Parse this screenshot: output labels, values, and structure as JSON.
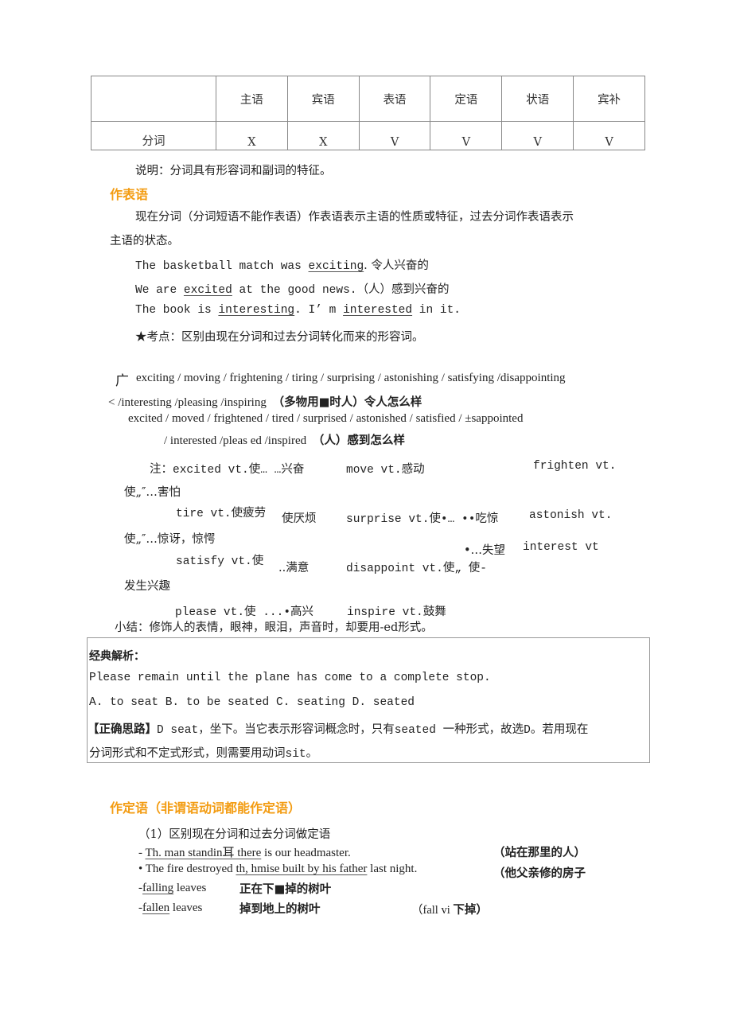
{
  "table": {
    "headers": [
      "",
      "主语",
      "宾语",
      "表语",
      "定语",
      "状语",
      "宾补"
    ],
    "rows": [
      [
        "分词",
        "X",
        "X",
        "V",
        "V",
        "V",
        "V"
      ]
    ]
  },
  "note": "说明：分词具有形容词和副词的特征。",
  "section1": {
    "heading": "作表语",
    "intro_line1": "现在分词（分词短语不能作表语）作表语表示主语的性质或特征，过去分词作表语表示",
    "intro_line2": "主语的状态。",
    "examples": [
      {
        "pre": "The basketball match was ",
        "u": "exciting",
        "post": ". 令人兴奋的"
      },
      {
        "pre": "We are ",
        "u": "excited",
        "post": " at the good news.（人）感到兴奋的"
      },
      {
        "pre": "The book is ",
        "u": "interesting",
        "mid": ". I’  m ",
        "u2": "interested",
        "post": " in it."
      }
    ],
    "key_point": "★考点：区别由现在分词和过去分词转化而来的形容词。",
    "list1_mark": "广",
    "list1_line1": "exciting / moving / frightening / tiring / surprising / astonishing / satisfying /disappointing",
    "list1_line2_en": "< /interesting /pleasing /inspiring",
    "list1_line2_cn": "（多物用■时人）令人怎么样",
    "list2_line1": "excited / moved / frightened / tired / surprised / astonished / satisfied / ±sappointed",
    "list2_line2_en": "/ interested /pleas ed /inspired",
    "list2_line2_cn": "（人）感到怎么样",
    "verbs": {
      "r1a": "注：excited vt.使… …兴奋",
      "r1b": "move vt.感动",
      "r1c": "frighten vt.",
      "r2a": "使„″…害怕",
      "r3a": "tire vt.使疲劳",
      "r3b": "使厌烦",
      "r3c": "surprise vt.使•… ••吃惊",
      "r3d": "astonish vt.",
      "r4a": "使„″…惊讶，惊愕",
      "r5a": "•…失望",
      "r5b": "interest vt",
      "r6a": "satisfy vt.使",
      "r6b": "..满意",
      "r6c": "disappoint vt.使„ 使-",
      "r7a": "发生兴趣",
      "r8a": "please vt.使 ...•高兴",
      "r8b": "inspire vt.鼓舞"
    },
    "summary": "小结：修饰人的表情，眼神，眼泪，声音时，却要用-ed形式。"
  },
  "analysis_box": {
    "title": "经典解析：",
    "question": "Please remain  until the plane has come to a complete stop.",
    "options": "A. to seat B. to be seated C. seating D. seated",
    "answer_label": "【正确思路】",
    "answer_line1": "D seat，坐下。当它表示形容词概念时，只有seated 一种形式，故选D。若用现在",
    "answer_line2": "分词形式和不定式形式，则需要用动词sit。"
  },
  "section2": {
    "heading": "作定语（非谓语动词都能作定语）",
    "sub": "（1）区别现在分词和过去分词做定语",
    "ex1_pre": "- ",
    "ex1_u": "Th. man standin耳  there",
    "ex1_post": " is our headmaster.",
    "ex1_cn": "（站在那里的人）",
    "ex2_pre": "• The fire destroyed ",
    "ex2_u": "th, hmise built by his father",
    "ex2_post": " last night.",
    "ex2_cn": "（他父亲修的房子",
    "ex3_pre": "-",
    "ex3_u": "falling",
    "ex3_post": " leaves",
    "ex3_cn": "正在下■掉的树叶",
    "ex4_pre": "-",
    "ex4_u": "fallen",
    "ex4_post": " leaves",
    "ex4_cn": "掉到地上的树叶",
    "ex4_note_en": "（fall vi ",
    "ex4_note_cn": "下掉）"
  }
}
